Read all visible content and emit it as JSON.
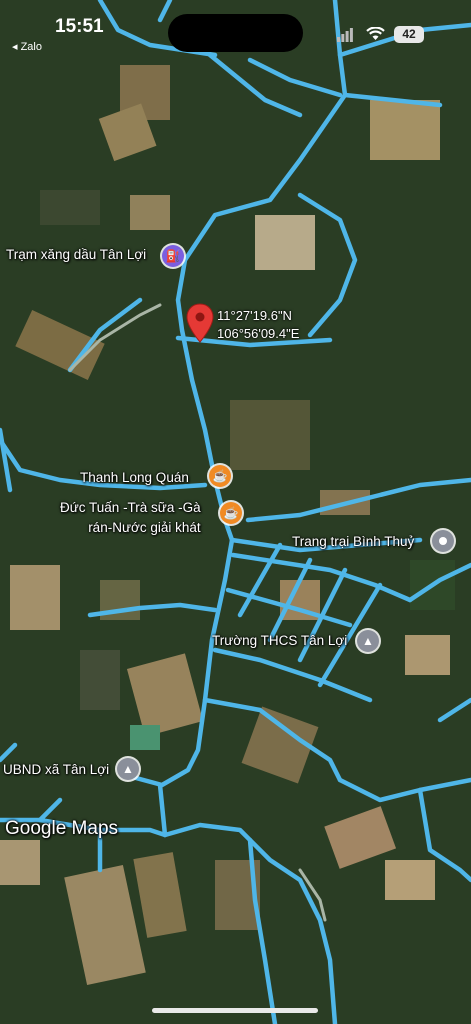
{
  "status_bar": {
    "time": "15:51",
    "back_app": "◂ Zalo",
    "battery": "42"
  },
  "pin": {
    "lat": "11°27'19.6\"N",
    "lng": "106°56'09.4\"E",
    "color": "#e53935"
  },
  "places": {
    "gas_station": {
      "name": "Trạm xăng dầu Tân Lợi",
      "icon": "gas-pump-icon",
      "color": "#7b5ee0"
    },
    "thanh_long": {
      "name": "Thanh Long Quán",
      "icon": "cafe-icon",
      "color": "#f08a24"
    },
    "duc_tuan": {
      "line1": "Đức Tuấn -Trà sữa -Gà",
      "line2": "rán-Nước giải khát",
      "icon": "cafe-icon",
      "color": "#f08a24"
    },
    "binh_thuy": {
      "name": "Trang trại Bình Thuỷ",
      "icon": "pin-dot-icon",
      "color": "#8a8f9a"
    },
    "school": {
      "name": "Trường THCS Tân Lợi",
      "icon": "school-icon",
      "color": "#8a8f9a"
    },
    "ubnd": {
      "name": "UBND xã Tân Lợi",
      "icon": "government-icon",
      "color": "#8a8f9a"
    }
  },
  "watermark": "Google Maps",
  "colors": {
    "road": "#4fb6e8",
    "terrain": "#2a3d24",
    "field": "#8d7a52"
  }
}
